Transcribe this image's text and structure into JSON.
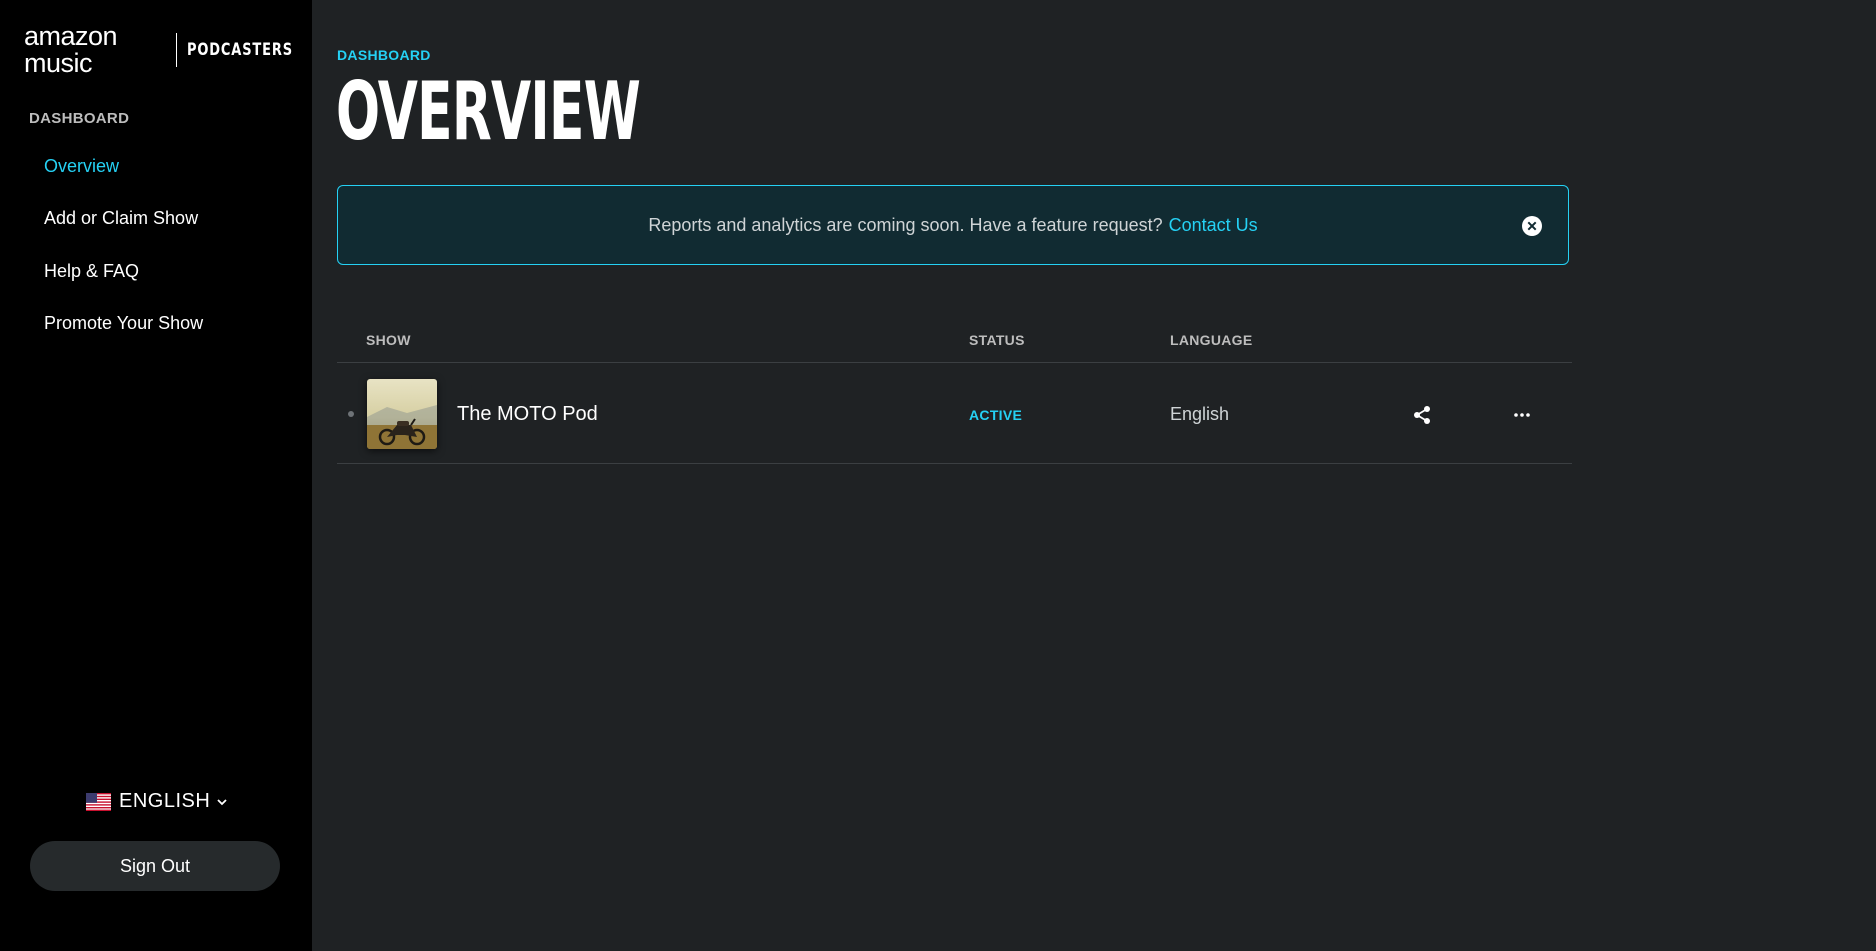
{
  "brand": {
    "logo_text": "amazon music",
    "logo_sub": "PODCASTERS"
  },
  "sidebar": {
    "heading": "DASHBOARD",
    "items": [
      {
        "label": "Overview",
        "active": true
      },
      {
        "label": "Add or Claim Show",
        "active": false
      },
      {
        "label": "Help & FAQ",
        "active": false
      },
      {
        "label": "Promote Your Show",
        "active": false
      }
    ],
    "language": {
      "flag_icon": "us-flag-icon",
      "label": "ENGLISH"
    },
    "sign_out_label": "Sign Out"
  },
  "main": {
    "breadcrumb": "DASHBOARD",
    "title": "OVERVIEW",
    "banner": {
      "text": "Reports and analytics are coming soon. Have a feature request?",
      "link": "Contact Us",
      "close_icon": "close-circle-icon"
    },
    "table": {
      "columns": [
        "SHOW",
        "STATUS",
        "LANGUAGE"
      ],
      "rows": [
        {
          "thumbnail": "motorcycle-artwork",
          "name": "The MOTO Pod",
          "status": "ACTIVE",
          "language": "English",
          "actions": [
            "share-icon",
            "more-horizontal-icon"
          ]
        }
      ]
    }
  },
  "colors": {
    "accent": "#25d1f4",
    "background": "#1f2224",
    "sidebar": "#000000",
    "banner_bg": "#112b32"
  }
}
